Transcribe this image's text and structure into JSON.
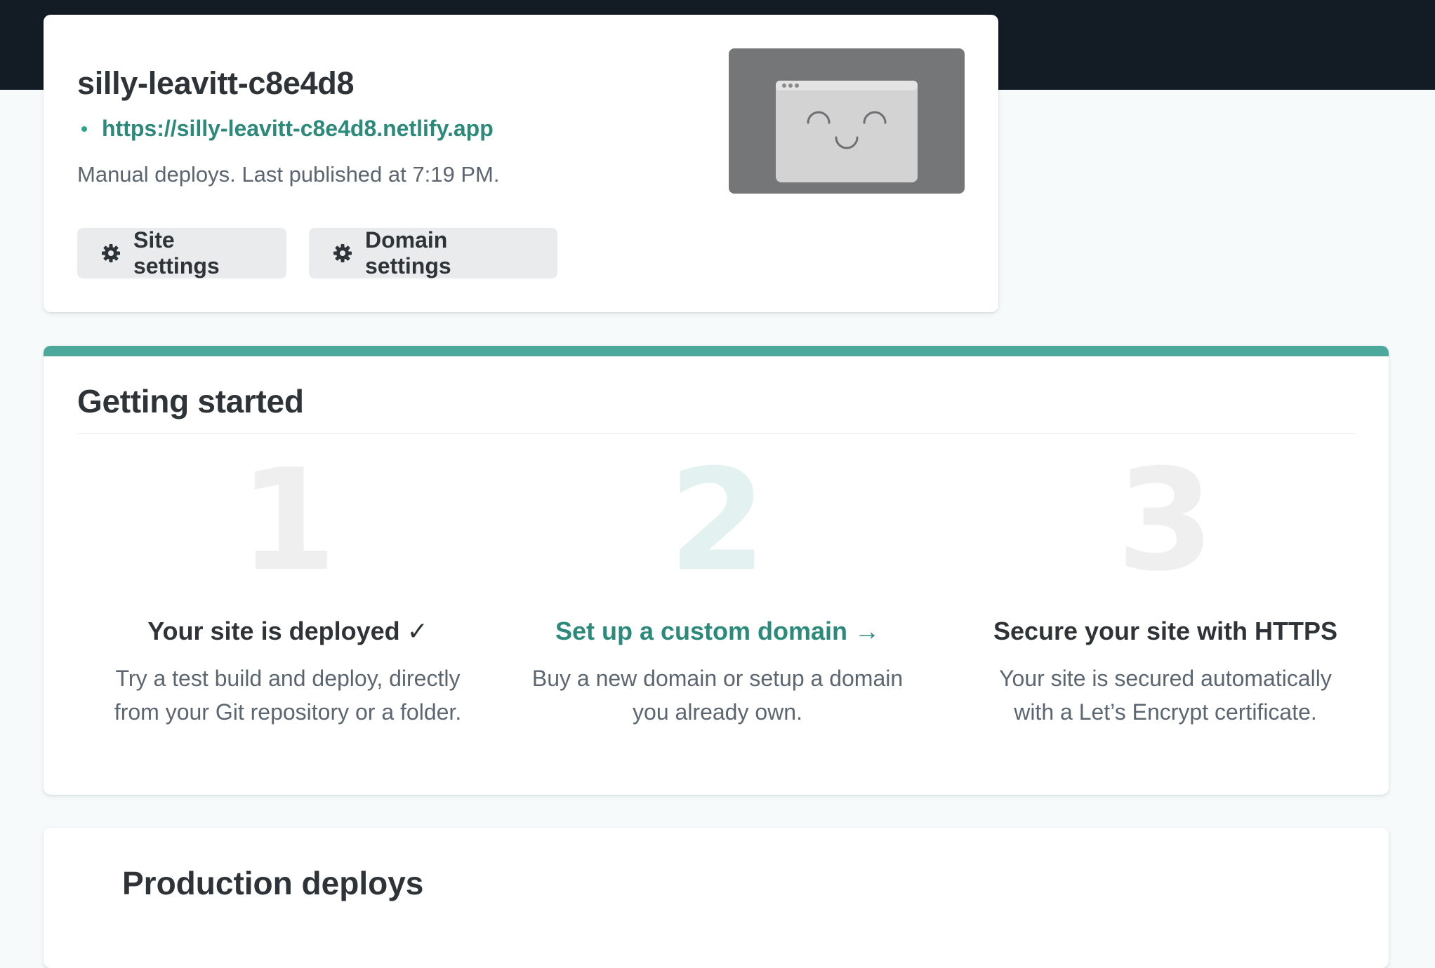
{
  "site": {
    "name": "silly-leavitt-c8e4d8",
    "url": "https://silly-leavitt-c8e4d8.netlify.app",
    "status": "Manual deploys. Last published at 7:19 PM.",
    "buttons": {
      "site_settings": "Site settings",
      "domain_settings": "Domain settings"
    },
    "icons": {
      "settings": "gear-icon",
      "preview": "site-preview-placeholder"
    }
  },
  "getting_started": {
    "title": "Getting started",
    "steps": [
      {
        "number": "1",
        "title": "Your site is deployed ✓",
        "description_line1": "Try a test build and deploy, directly",
        "description_line2": "from your Git repository or a folder."
      },
      {
        "number": "2",
        "title": "Set up a custom domain →",
        "description_line1": "Buy a new domain or setup a domain",
        "description_line2": "you already own."
      },
      {
        "number": "3",
        "title": "Secure your site with HTTPS",
        "description_line1": "Your site is secured automatically",
        "description_line2": "with a Let’s Encrypt certificate."
      }
    ]
  },
  "next_section": {
    "title": "Production deploys"
  },
  "colors": {
    "topbar": "#131c24",
    "accent": "#4ca89a",
    "link": "#2b8a7a",
    "background": "#f6fafa"
  }
}
